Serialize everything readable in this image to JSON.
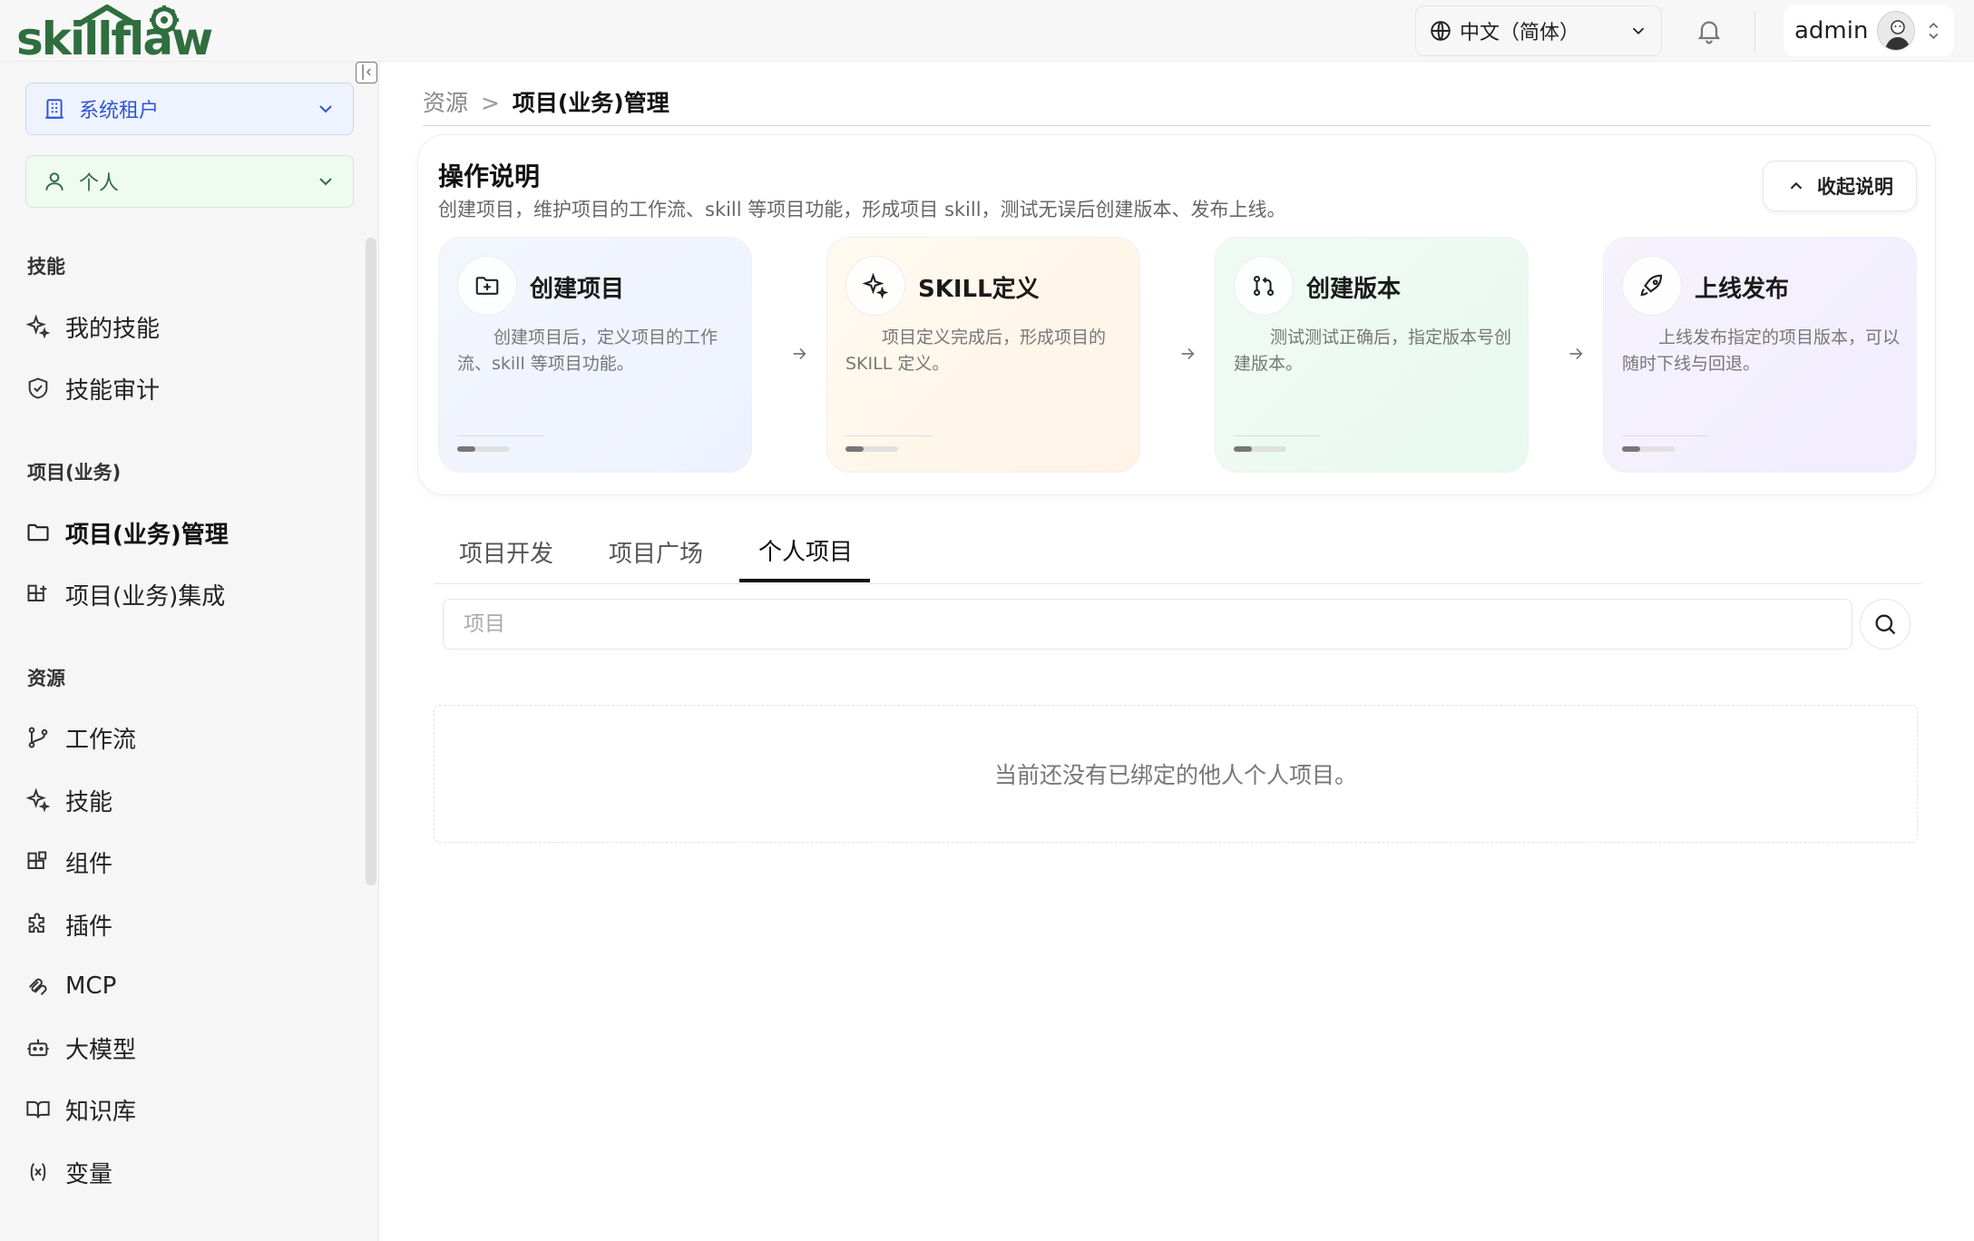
{
  "header": {
    "logo_text": "skillflaw",
    "language": "中文（简体）",
    "user_name": "admin"
  },
  "sidebar": {
    "tenant_select": "系统租户",
    "scope_select": "个人",
    "sections": [
      {
        "title": "技能",
        "items": [
          {
            "label": "我的技能",
            "icon": "sparkle-icon"
          },
          {
            "label": "技能审计",
            "icon": "shield-check-icon"
          }
        ]
      },
      {
        "title": "项目(业务)",
        "items": [
          {
            "label": "项目(业务)管理",
            "icon": "folder-icon",
            "active": true
          },
          {
            "label": "项目(业务)集成",
            "icon": "blocks-plus-icon"
          }
        ]
      },
      {
        "title": "资源",
        "items": [
          {
            "label": "工作流",
            "icon": "git-branch-icon"
          },
          {
            "label": "技能",
            "icon": "sparkle-icon"
          },
          {
            "label": "组件",
            "icon": "component-blocks-icon"
          },
          {
            "label": "插件",
            "icon": "puzzle-icon"
          },
          {
            "label": "MCP",
            "icon": "mcp-icon"
          },
          {
            "label": "大模型",
            "icon": "robot-icon"
          },
          {
            "label": "知识库",
            "icon": "book-open-icon"
          },
          {
            "label": "变量",
            "icon": "variable-icon"
          }
        ]
      }
    ]
  },
  "breadcrumb": {
    "parent": "资源",
    "separator": ">",
    "current": "项目(业务)管理"
  },
  "guide": {
    "title": "操作说明",
    "description": "创建项目，维护项目的工作流、skill 等项目功能，形成项目 skill，测试无误后创建版本、发布上线。",
    "collapse_label": "收起说明",
    "steps": [
      {
        "title": "创建项目",
        "desc": "创建项目后，定义项目的工作流、skill 等项目功能。",
        "icon": "folder-plus-icon",
        "progress": 0.35
      },
      {
        "title": "SKILL定义",
        "desc": "项目定义完成后，形成项目的 SKILL 定义。",
        "icon": "sparkle-icon",
        "progress": 0.35
      },
      {
        "title": "创建版本",
        "desc": "测试测试正确后，指定版本号创建版本。",
        "icon": "git-pull-request-icon",
        "progress": 0.35
      },
      {
        "title": "上线发布",
        "desc": "上线发布指定的项目版本，可以随时下线与回退。",
        "icon": "rocket-icon",
        "progress": 0.35
      }
    ]
  },
  "tabs": [
    {
      "label": "项目开发",
      "active": false
    },
    {
      "label": "项目广场",
      "active": false
    },
    {
      "label": "个人项目",
      "active": true
    }
  ],
  "search": {
    "placeholder": "项目",
    "value": ""
  },
  "empty_state": {
    "message": "当前还没有已绑定的他人个人项目。"
  },
  "colors": {
    "tenant_accent": "#2f55d4",
    "personal_accent": "#2f6e3f",
    "logo": "#2f6e3f"
  }
}
